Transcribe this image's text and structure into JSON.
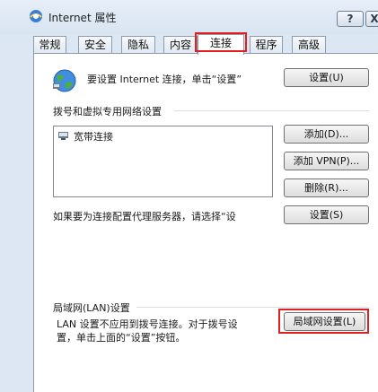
{
  "window": {
    "title": "Internet 属性",
    "help_label": "?",
    "close_label": "X"
  },
  "tabs": [
    {
      "label": "常规"
    },
    {
      "label": "安全"
    },
    {
      "label": "隐私"
    },
    {
      "label": "内容"
    },
    {
      "label": "连接"
    },
    {
      "label": "程序"
    },
    {
      "label": "高级"
    }
  ],
  "active_tab": "连接",
  "connection": {
    "setup_text": "要设置 Internet 连接，单击“设置”",
    "setup_button": "设置(U)",
    "dialup_group_label": "拨号和虚拟专用网络设置",
    "list_items": [
      {
        "label": "宽带连接",
        "icon": "network-connection-icon"
      }
    ],
    "add_button": "添加(D)...",
    "add_vpn_button": "添加 VPN(P)...",
    "delete_button": "删除(R)...",
    "proxy_text": "如果要为连接配置代理服务器，请选择“设",
    "proxy_settings_button": "设置(S)"
  },
  "lan": {
    "group_label": "局域网(LAN)设置",
    "description_line1": "LAN 设置不应用到拨号连接。对于拨号设",
    "description_line2": "置，单击上面的“设置”按钮。",
    "settings_button": "局域网设置(L)"
  },
  "colors": {
    "highlight": "#e0201e",
    "window_bg": "#dce7f3"
  }
}
